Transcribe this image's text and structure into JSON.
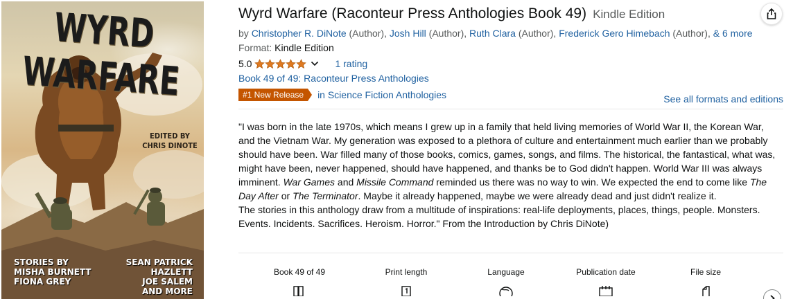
{
  "cover": {
    "title": "WYRD WARFARE",
    "edited_by": "EDITED BY",
    "editor": "CHRIS DINOTE",
    "credits_left": [
      "STORIES BY",
      "MISHA BURNETT",
      "FIONA GREY"
    ],
    "credits_right": [
      "SEAN PATRICK HAZLETT",
      "JOE SALEM",
      "AND MORE"
    ]
  },
  "product": {
    "title": "Wyrd Warfare (Raconteur Press Anthologies Book 49)",
    "format_suffix": "Kindle Edition"
  },
  "byline": {
    "prefix": "by ",
    "authors": [
      {
        "name": "Christopher R. DiNote",
        "role": " (Author), "
      },
      {
        "name": "Josh Hill",
        "role": " (Author), "
      },
      {
        "name": "Ruth Clara",
        "role": " (Author), "
      },
      {
        "name": "Frederick Gero Himebach",
        "role": " (Author), "
      }
    ],
    "more": "& 6 more"
  },
  "format": {
    "label": "Format: ",
    "value": "Kindle Edition"
  },
  "rating": {
    "value": "5.0",
    "stars": 5,
    "count_label": "1 rating"
  },
  "series": {
    "label": "Book 49 of 49: Raconteur Press Anthologies"
  },
  "badge": {
    "label": "#1 New Release",
    "category": "in Science Fiction Anthologies"
  },
  "see_formats": "See all formats and editions",
  "description": {
    "p1_a": "\"I was born in the late 1970s, which means I grew up in a family that held living memories of World War II, the Korean War, and the Vietnam War. My generation was exposed to a plethora of culture and entertainment much earlier than we probably should have been. War filled many of those books, comics, games, songs, and films. The historical, the fantastical, what was, might have been, never happened, should have happened, and thanks be to God didn't happen. World War III was always imminent. ",
    "p1_i1": "War Games",
    "p1_b": " and ",
    "p1_i2": "Missile Command",
    "p1_c": " reminded us there was no way to win. We expected the end to come like ",
    "p1_i3": "The Day After",
    "p1_d": " or ",
    "p1_i4": "The Terminator",
    "p1_e": ". Maybe it already happened, maybe we were already dead and just didn't realize it.",
    "p2": "The stories in this anthology draw from a multitude of inspirations: real-life deployments, places, things, people. Monsters. Events. Incidents. Sacrifices. Heroism. Horror.\" From the Introduction by Chris DiNote)"
  },
  "details": [
    {
      "label": "Book 49 of 49",
      "icon": "books-icon"
    },
    {
      "label": "Print length",
      "icon": "page-count-icon"
    },
    {
      "label": "Language",
      "icon": "globe-icon"
    },
    {
      "label": "Publication date",
      "icon": "calendar-icon"
    },
    {
      "label": "File size",
      "icon": "file-icon"
    }
  ],
  "colors": {
    "link": "#2162a1",
    "badge": "#c45500",
    "star": "#de7921",
    "text": "#0f1111",
    "muted": "#565959"
  }
}
